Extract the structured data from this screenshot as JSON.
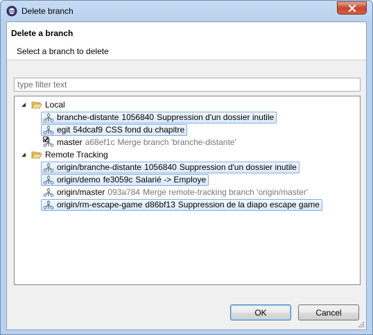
{
  "window": {
    "title": "Delete branch"
  },
  "header": {
    "title": "Delete a branch",
    "subtitle": "Select a branch to delete"
  },
  "filter": {
    "placeholder": "type filter text",
    "value": ""
  },
  "tree": {
    "groups": [
      {
        "label": "Local",
        "expanded": true,
        "items": [
          {
            "name": "branche-distante",
            "commit": "1056840",
            "message": "Suppression d'un dossier inutile",
            "selected": true,
            "checked_out": false
          },
          {
            "name": "egit",
            "commit": "54dcaf9",
            "message": "CSS fond du chapitre",
            "selected": true,
            "checked_out": false
          },
          {
            "name": "master",
            "commit": "a68ef1c",
            "message": "Merge branch 'branche-distante'",
            "selected": false,
            "checked_out": true
          }
        ]
      },
      {
        "label": "Remote Tracking",
        "expanded": true,
        "items": [
          {
            "name": "origin/branche-distante",
            "commit": "1056840",
            "message": "Suppression d'un dossier inutile",
            "selected": true,
            "checked_out": false
          },
          {
            "name": "origin/demo",
            "commit": "fe3059c",
            "message": "Salarié -> Employe",
            "selected": true,
            "checked_out": false
          },
          {
            "name": "origin/master",
            "commit": "093a784",
            "message": "Merge remote-tracking branch 'origin/master'",
            "selected": false,
            "checked_out": false
          },
          {
            "name": "origin/rm-escape-game",
            "commit": "d86bf13",
            "message": "Suppression de la diapo escape game",
            "selected": true,
            "checked_out": false
          }
        ]
      }
    ]
  },
  "buttons": {
    "ok": "OK",
    "cancel": "Cancel"
  },
  "colors": {
    "selection_border": "#84acdd",
    "selection_fill": "#dbe9fb",
    "dim_text": "#777777"
  }
}
